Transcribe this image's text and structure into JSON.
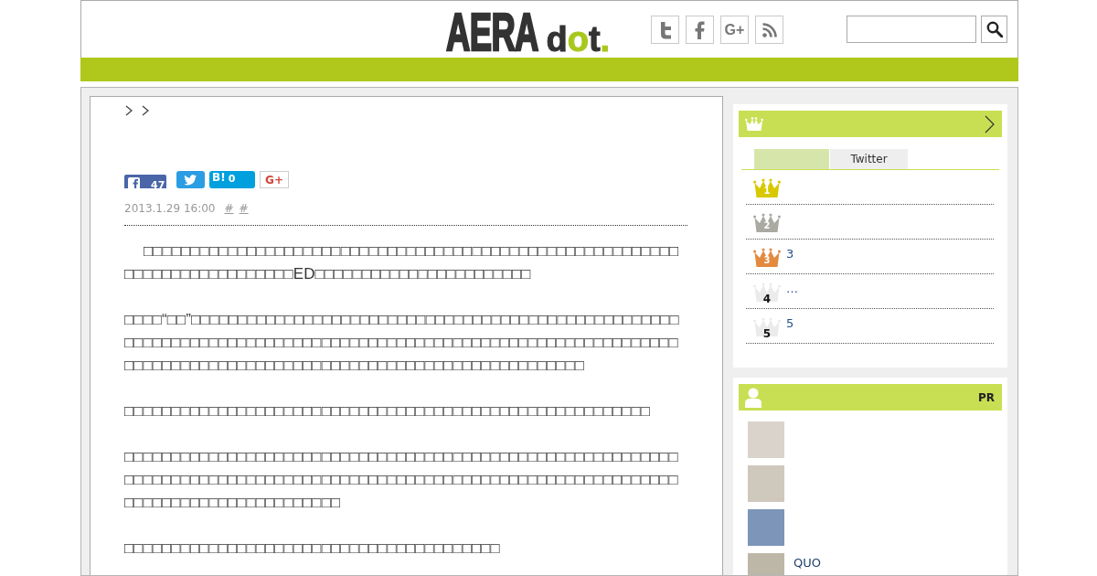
{
  "header": {
    "logo": {
      "wordmark": "AERA",
      "suffix_parts": [
        {
          "text": "d",
          "accent": false
        },
        {
          "text": "o",
          "accent": true
        },
        {
          "text": "t",
          "accent": false
        },
        {
          "text": ".",
          "accent": true
        }
      ]
    },
    "social_links": [
      {
        "kind": "t"
      },
      {
        "kind": "f"
      },
      {
        "kind": "text",
        "label": "G+"
      },
      {
        "kind": "rss"
      }
    ]
  },
  "article": {
    "share_buttons": [
      {
        "kind": "facebook",
        "count": "47"
      },
      {
        "kind": "twitter"
      },
      {
        "kind": "hatena",
        "label": "B!",
        "count": "0"
      },
      {
        "kind": "google_plus",
        "label": "G+"
      }
    ],
    "date": "2013.1.29 16:00",
    "tags": [
      "#",
      "#"
    ],
    "paragraphs": [
      {
        "indent": true,
        "text": "□□□□□□□□□□□□□□□□□□□□□□□□□□□□□□□□□□□□□□□□□□□□□□□□□□□□□□□□□□□□□□□□□□□□□□□□□□□ED□□□□□□□□□□□□□□□□□□□□□□□"
      },
      {
        "indent": false,
        "text": "□□□□“□□”□□□□□□□□□□□□□□□□□□□□□□□□□□□□□□□□□□□□□□□□□□□□□□□□□□□□□□□□□□□□□□□□□□□□□□□□□□□□□□□□□□□□□□□□□□□□□□□□□□□□□□□□□□□□□□□□□□□□□□□□□□□□□□□□□□□□□□□□□□□□□□□□□□□□□□□□□□□□□□□□"
      },
      {
        "indent": false,
        "text": "□□□□□□□□□□□□□□□□□□□□□□□□□□□□□□□□□□□□□□□□□□□□□□□□□□□□□□□□"
      },
      {
        "indent": false,
        "text": "□□□□□□□□□□□□□□□□□□□□□□□□□□□□□□□□□□□□□□□□□□□□□□□□□□□□□□□□□□□□□□□□□□□□□□□□□□□□□□□□□□□□□□□□□□□□□□□□□□□□□□□□□□□□□□□□□□□□□□□□□□□□□□□□□□□□□□□□□□□□□"
      },
      {
        "indent": false,
        "text": "□□□□□□□□□□□□□□□□□□□□□□□□□□□□□□□□□□□□□□□□"
      }
    ]
  },
  "ranking": {
    "tabs": [
      {
        "selected": true
      },
      {
        "label": "Twitter",
        "selected": false
      }
    ],
    "items": [
      {
        "rank": "1",
        "color": "#d8c800"
      },
      {
        "rank": "2",
        "color": "#aaaaa2"
      },
      {
        "rank": "3",
        "color": "#e38a3f",
        "title": "3"
      },
      {
        "rank": "4",
        "color": "#ebebeb",
        "title": "…"
      },
      {
        "rank": "5",
        "color": "#ebebeb",
        "title": "5"
      }
    ]
  },
  "pr": {
    "label": "PR",
    "items": [
      {
        "kind": "photo"
      },
      {
        "kind": "photo"
      },
      {
        "kind": "photo"
      },
      {
        "kind": "photo",
        "title": "QUO"
      }
    ]
  }
}
